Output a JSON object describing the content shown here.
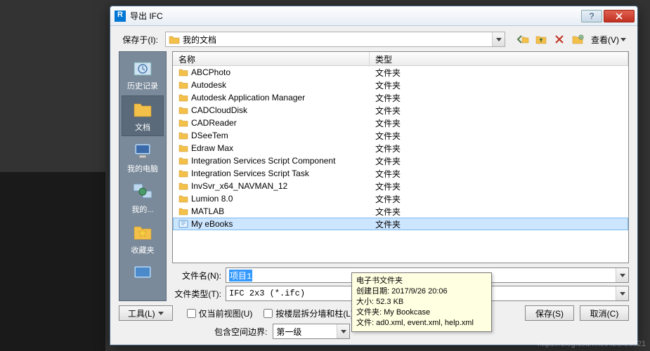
{
  "window": {
    "title": "导出 IFC",
    "help_btn": "?",
    "close_btn": "×"
  },
  "savein": {
    "label": "保存于(I):",
    "value": "我的文档"
  },
  "toolbar": {
    "back": "back",
    "up": "up",
    "delete": "delete",
    "newfolder": "newfolder",
    "views_label": "查看(V)"
  },
  "places": [
    {
      "label": "历史记录",
      "icon": "history"
    },
    {
      "label": "文档",
      "icon": "documents"
    },
    {
      "label": "我的电脑",
      "icon": "computer"
    },
    {
      "label": "我的...",
      "icon": "network"
    },
    {
      "label": "收藏夹",
      "icon": "favorites"
    },
    {
      "label": "",
      "icon": "desktop"
    }
  ],
  "list": {
    "header_name": "名称",
    "header_type": "类型",
    "rows": [
      {
        "name": "ABCPhoto",
        "type": "文件夹",
        "kind": "folder"
      },
      {
        "name": "Autodesk",
        "type": "文件夹",
        "kind": "folder"
      },
      {
        "name": "Autodesk Application Manager",
        "type": "文件夹",
        "kind": "folder"
      },
      {
        "name": "CADCloudDisk",
        "type": "文件夹",
        "kind": "folder"
      },
      {
        "name": "CADReader",
        "type": "文件夹",
        "kind": "folder"
      },
      {
        "name": "DSeeTem",
        "type": "文件夹",
        "kind": "folder"
      },
      {
        "name": "Edraw Max",
        "type": "文件夹",
        "kind": "folder"
      },
      {
        "name": "Integration Services Script Component",
        "type": "文件夹",
        "kind": "folder"
      },
      {
        "name": "Integration Services Script Task",
        "type": "文件夹",
        "kind": "folder"
      },
      {
        "name": "InvSvr_x64_NAVMAN_12",
        "type": "文件夹",
        "kind": "folder"
      },
      {
        "name": "Lumion 8.0",
        "type": "文件夹",
        "kind": "folder"
      },
      {
        "name": "MATLAB",
        "type": "文件夹",
        "kind": "folder"
      },
      {
        "name": "My eBooks",
        "type": "文件夹",
        "kind": "ebook",
        "selected": true
      }
    ]
  },
  "filename": {
    "label": "文件名(N):",
    "value": "项目1"
  },
  "filetype": {
    "label": "文件类型(T):",
    "value": "IFC 2x3 (*.ifc)"
  },
  "tooltip": {
    "line1": "电子书文件夹",
    "line2": "创建日期: 2017/9/26 20:06",
    "line3": "大小: 52.3 KB",
    "line4": "文件夹: My Bookcase",
    "line5": "文件: ad0.xml, event.xml, help.xml"
  },
  "bottom": {
    "tools": "工具(L)",
    "chk_current_view": "仅当前视图(U)",
    "chk_split": "按楼层拆分墙和柱(L)",
    "spatial_label": "包含空间边界:",
    "spatial_value": "第一级",
    "save": "保存(S)",
    "cancel": "取消(C)"
  },
  "watermark": "https://blog.csdn.net/xzdxzd321"
}
